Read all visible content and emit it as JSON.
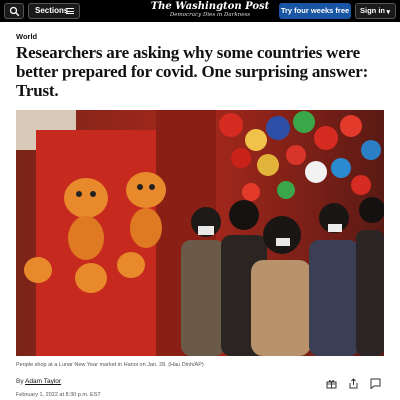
{
  "header": {
    "sections_label": "Sections",
    "brand_name": "The Washington Post",
    "brand_tagline": "Democracy Dies in Darkness",
    "subscribe_label": "Try four weeks free",
    "signin_label": "Sign in",
    "colors": {
      "bar": "#000000",
      "subscribe": "#1955a5"
    },
    "icons": [
      "search-icon",
      "menu-icon",
      "chevron-down-icon"
    ]
  },
  "article": {
    "section": "World",
    "headline": "Researchers are asking why some countries were better prepared for covid. One surprising answer: Trust.",
    "photo_caption": "People shop at a Lunar New Year market in Hanoi on Jan. 28. (Hau Dinh/AP)",
    "byline_prefix": "By",
    "author": "Adam Taylor",
    "date": "February 1, 2022 at 8:30 p.m. EST",
    "actions": [
      "gift-icon",
      "share-icon",
      "comment-icon"
    ]
  }
}
